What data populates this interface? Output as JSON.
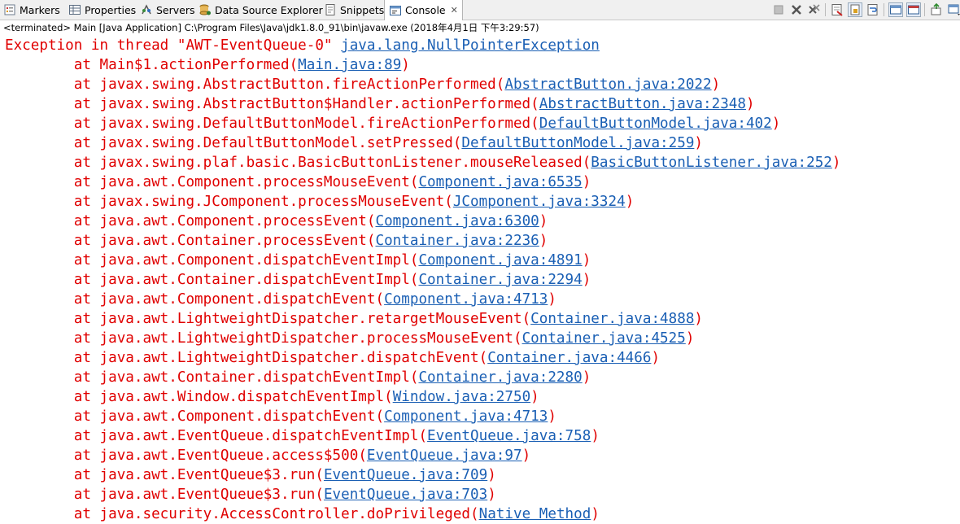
{
  "tabs": [
    {
      "label": "Markers",
      "icon": "markers-icon"
    },
    {
      "label": "Properties",
      "icon": "properties-icon"
    },
    {
      "label": "Servers",
      "icon": "servers-icon"
    },
    {
      "label": "Data Source Explorer",
      "icon": "database-icon"
    },
    {
      "label": "Snippets",
      "icon": "snippets-icon"
    },
    {
      "label": "Console",
      "icon": "console-icon",
      "active": true,
      "close": "✕"
    }
  ],
  "status": "<terminated> Main [Java Application] C:\\Program Files\\Java\\jdk1.8.0_91\\bin\\javaw.exe (2018年4月1日 下午3:29:57)",
  "console": {
    "exception_prefix": "Exception in thread \"AWT-EventQueue-0\" ",
    "exception_class": "java.lang.NullPointerException",
    "frames": [
      {
        "method": "Main$1.actionPerformed",
        "source": "Main.java:89"
      },
      {
        "method": "javax.swing.AbstractButton.fireActionPerformed",
        "source": "AbstractButton.java:2022"
      },
      {
        "method": "javax.swing.AbstractButton$Handler.actionPerformed",
        "source": "AbstractButton.java:2348"
      },
      {
        "method": "javax.swing.DefaultButtonModel.fireActionPerformed",
        "source": "DefaultButtonModel.java:402"
      },
      {
        "method": "javax.swing.DefaultButtonModel.setPressed",
        "source": "DefaultButtonModel.java:259"
      },
      {
        "method": "javax.swing.plaf.basic.BasicButtonListener.mouseReleased",
        "source": "BasicButtonListener.java:252"
      },
      {
        "method": "java.awt.Component.processMouseEvent",
        "source": "Component.java:6535"
      },
      {
        "method": "javax.swing.JComponent.processMouseEvent",
        "source": "JComponent.java:3324"
      },
      {
        "method": "java.awt.Component.processEvent",
        "source": "Component.java:6300"
      },
      {
        "method": "java.awt.Container.processEvent",
        "source": "Container.java:2236"
      },
      {
        "method": "java.awt.Component.dispatchEventImpl",
        "source": "Component.java:4891"
      },
      {
        "method": "java.awt.Container.dispatchEventImpl",
        "source": "Container.java:2294"
      },
      {
        "method": "java.awt.Component.dispatchEvent",
        "source": "Component.java:4713"
      },
      {
        "method": "java.awt.LightweightDispatcher.retargetMouseEvent",
        "source": "Container.java:4888"
      },
      {
        "method": "java.awt.LightweightDispatcher.processMouseEvent",
        "source": "Container.java:4525"
      },
      {
        "method": "java.awt.LightweightDispatcher.dispatchEvent",
        "source": "Container.java:4466"
      },
      {
        "method": "java.awt.Container.dispatchEventImpl",
        "source": "Container.java:2280"
      },
      {
        "method": "java.awt.Window.dispatchEventImpl",
        "source": "Window.java:2750"
      },
      {
        "method": "java.awt.Component.dispatchEvent",
        "source": "Component.java:4713"
      },
      {
        "method": "java.awt.EventQueue.dispatchEventImpl",
        "source": "EventQueue.java:758"
      },
      {
        "method": "java.awt.EventQueue.access$500",
        "source": "EventQueue.java:97"
      },
      {
        "method": "java.awt.EventQueue$3.run",
        "source": "EventQueue.java:709"
      },
      {
        "method": "java.awt.EventQueue$3.run",
        "source": "EventQueue.java:703"
      },
      {
        "method": "java.security.AccessController.doPrivileged",
        "source": "Native Method"
      }
    ]
  },
  "colors": {
    "error_text": "#e00000",
    "link": "#1a5fb4"
  }
}
